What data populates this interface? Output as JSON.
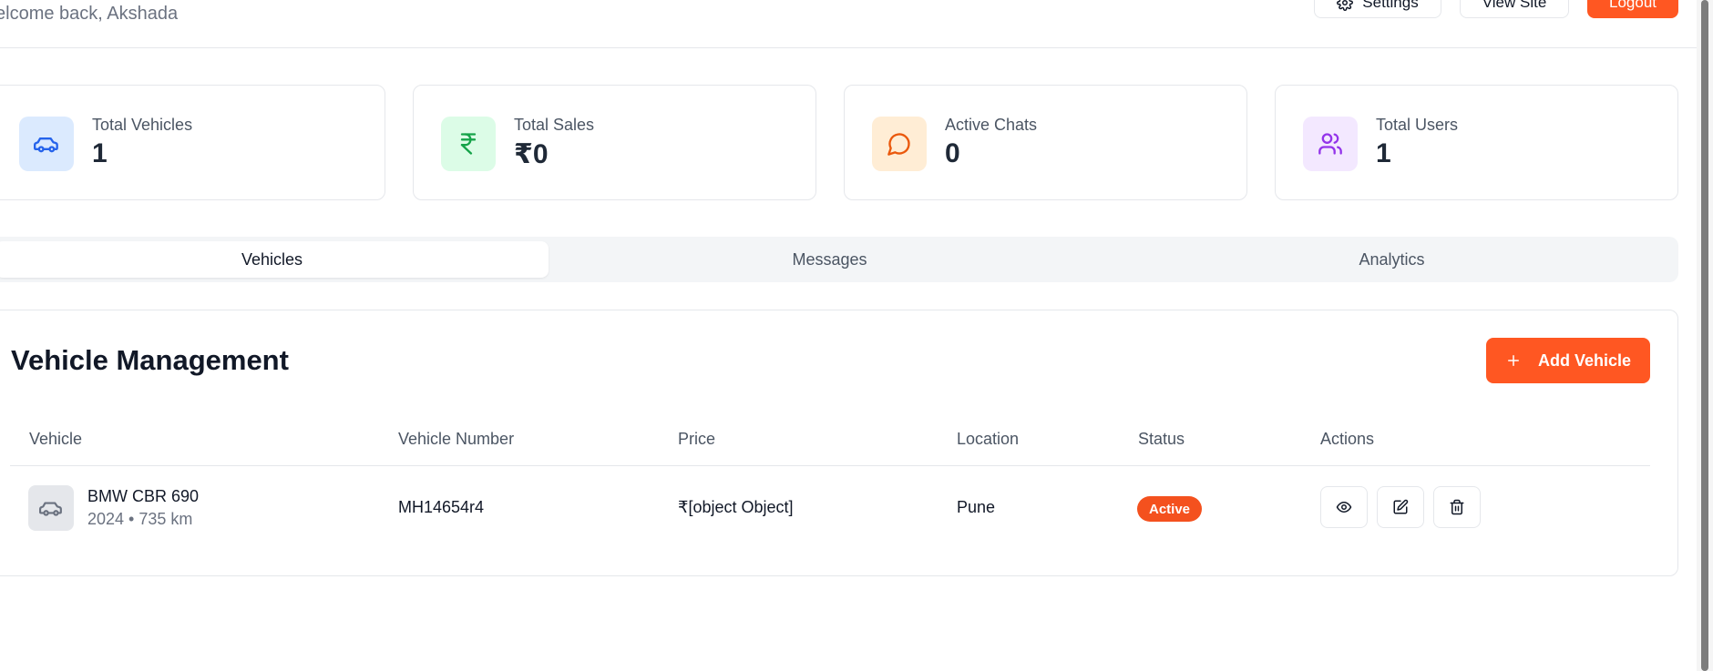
{
  "header": {
    "welcome": "elcome back, Akshada",
    "settings_label": "Settings",
    "view_site_label": "View Site",
    "logout_label": "Logout"
  },
  "stats": [
    {
      "label": "Total Vehicles",
      "value": "1",
      "icon": "car-icon",
      "color": "#2563eb",
      "bg": "#dbeafe"
    },
    {
      "label": "Total Sales",
      "value": "₹0",
      "icon": "rupee-icon",
      "color": "#16a34a",
      "bg": "#dcfce7"
    },
    {
      "label": "Active Chats",
      "value": "0",
      "icon": "message-circle-icon",
      "color": "#ea580c",
      "bg": "#ffedd5"
    },
    {
      "label": "Total Users",
      "value": "1",
      "icon": "users-icon",
      "color": "#9333ea",
      "bg": "#f3e8ff"
    }
  ],
  "tabs": [
    {
      "label": "Vehicles",
      "active": true
    },
    {
      "label": "Messages",
      "active": false
    },
    {
      "label": "Analytics",
      "active": false
    }
  ],
  "management": {
    "title": "Vehicle Management",
    "add_label": "Add Vehicle",
    "columns": [
      "Vehicle",
      "Vehicle Number",
      "Price",
      "Location",
      "Status",
      "Actions"
    ],
    "rows": [
      {
        "name": "BMW CBR 690",
        "meta": "2024 • 735 km",
        "number": "MH14654r4",
        "price": "₹[object Object]",
        "location": "Pune",
        "status": "Active"
      }
    ]
  },
  "colors": {
    "accent": "#ff5722",
    "status_active": "#f4511e"
  }
}
